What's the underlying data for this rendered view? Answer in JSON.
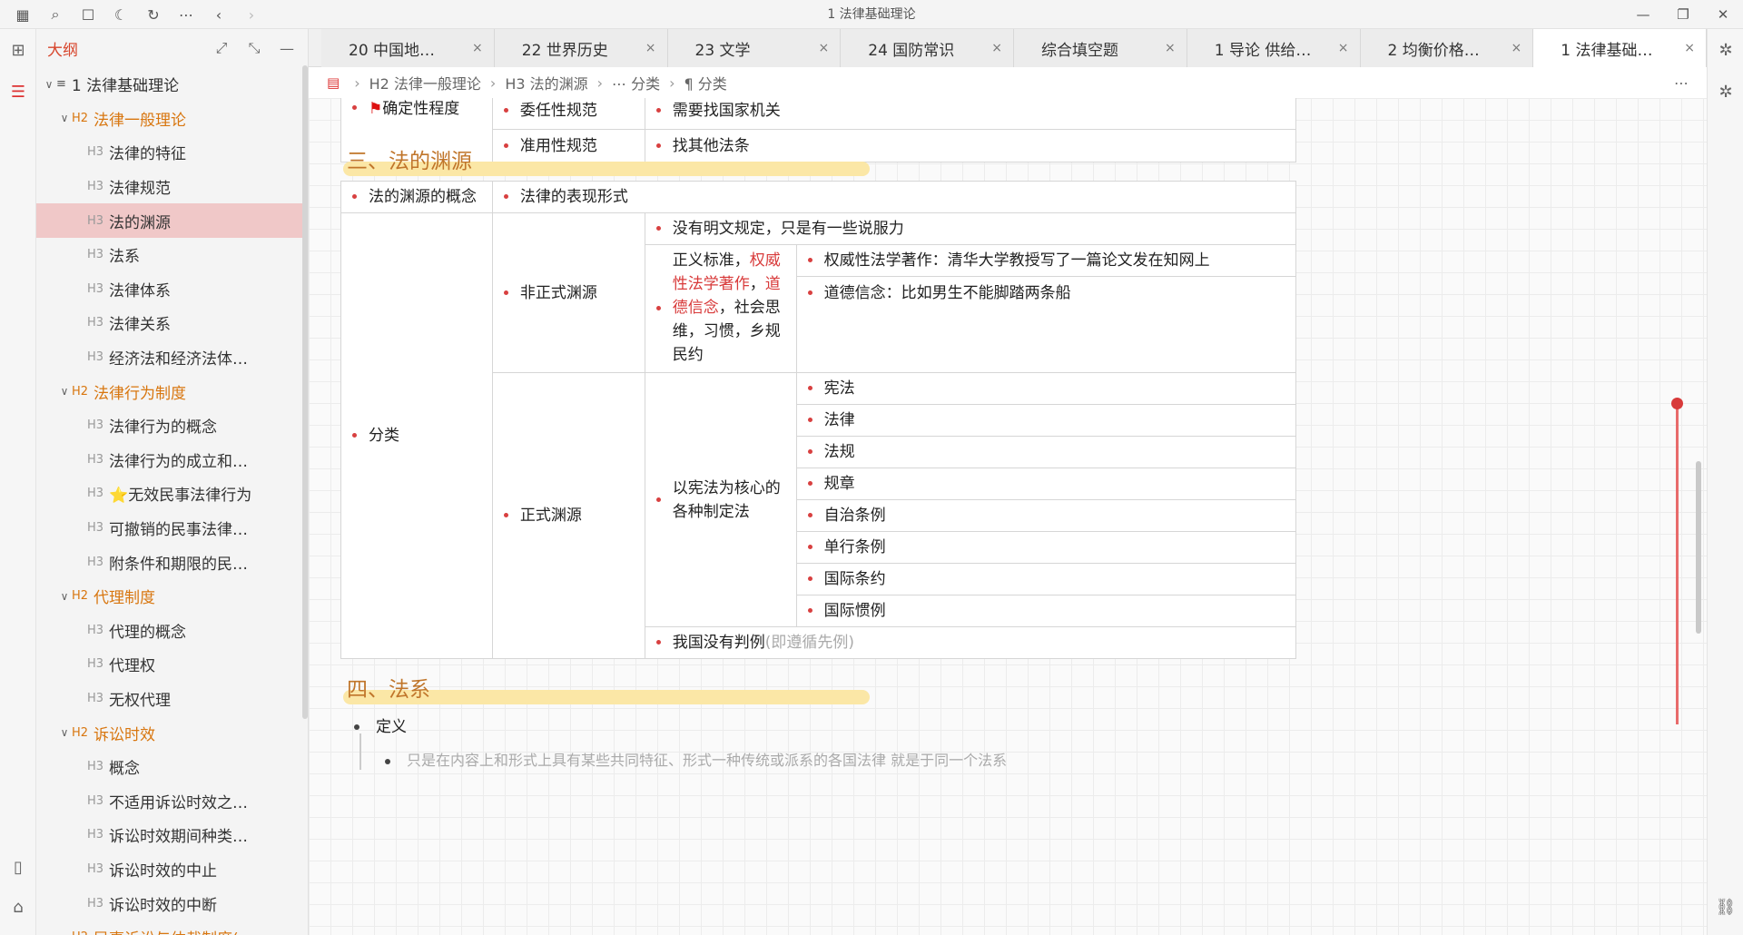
{
  "window": {
    "title": "1 法律基础理论"
  },
  "outline": {
    "title": "大纲",
    "items": [
      {
        "level": "",
        "text": "1 法律基础理论",
        "arrow": "∨",
        "indent": 0
      },
      {
        "level": "H2",
        "text": "法律一般理论",
        "arrow": "∨",
        "indent": 1
      },
      {
        "level": "H3",
        "text": "法律的特征",
        "arrow": "",
        "indent": 2
      },
      {
        "level": "H3",
        "text": "法律规范",
        "arrow": "",
        "indent": 2
      },
      {
        "level": "H3",
        "text": "法的渊源",
        "arrow": "",
        "indent": 2,
        "selected": true
      },
      {
        "level": "H3",
        "text": "法系",
        "arrow": "",
        "indent": 2
      },
      {
        "level": "H3",
        "text": "法律体系",
        "arrow": "",
        "indent": 2
      },
      {
        "level": "H3",
        "text": "法律关系",
        "arrow": "",
        "indent": 2
      },
      {
        "level": "H3",
        "text": "经济法和经济法体…",
        "arrow": "",
        "indent": 2
      },
      {
        "level": "H2",
        "text": "法律行为制度",
        "arrow": "∨",
        "indent": 1
      },
      {
        "level": "H3",
        "text": "法律行为的概念",
        "arrow": "",
        "indent": 2
      },
      {
        "level": "H3",
        "text": "法律行为的成立和…",
        "arrow": "",
        "indent": 2
      },
      {
        "level": "H3",
        "text": "⭐无效民事法律行为",
        "arrow": "",
        "indent": 2
      },
      {
        "level": "H3",
        "text": "可撤销的民事法律…",
        "arrow": "",
        "indent": 2
      },
      {
        "level": "H3",
        "text": "附条件和期限的民…",
        "arrow": "",
        "indent": 2
      },
      {
        "level": "H2",
        "text": "代理制度",
        "arrow": "∨",
        "indent": 1
      },
      {
        "level": "H3",
        "text": "代理的概念",
        "arrow": "",
        "indent": 2
      },
      {
        "level": "H3",
        "text": "代理权",
        "arrow": "",
        "indent": 2
      },
      {
        "level": "H3",
        "text": "无权代理",
        "arrow": "",
        "indent": 2
      },
      {
        "level": "H2",
        "text": "诉讼时效",
        "arrow": "∨",
        "indent": 1
      },
      {
        "level": "H3",
        "text": "概念",
        "arrow": "",
        "indent": 2
      },
      {
        "level": "H3",
        "text": "不适用诉讼时效之…",
        "arrow": "",
        "indent": 2
      },
      {
        "level": "H3",
        "text": "诉讼时效期间种类…",
        "arrow": "",
        "indent": 2
      },
      {
        "level": "H3",
        "text": "诉讼时效的中止",
        "arrow": "",
        "indent": 2
      },
      {
        "level": "H3",
        "text": "诉讼时效的中断",
        "arrow": "",
        "indent": 2
      },
      {
        "level": "H2",
        "text": "民事诉讼与仲裁制度(",
        "arrow": "∨",
        "indent": 1
      }
    ]
  },
  "tabs": [
    {
      "label": "20 中国地…",
      "active": false
    },
    {
      "label": "22 世界历史",
      "active": false
    },
    {
      "label": "23 文学",
      "active": false
    },
    {
      "label": "24 国防常识",
      "active": false
    },
    {
      "label": "综合填空题",
      "active": false
    },
    {
      "label": "1 导论 供给…",
      "active": false
    },
    {
      "label": "2 均衡价格…",
      "active": false
    },
    {
      "label": "1 法律基础…",
      "active": true
    }
  ],
  "breadcrumb": [
    "H2 法律一般理论",
    "H3 法的渊源",
    "⋯ 分类",
    "¶ 分类"
  ],
  "doc": {
    "table1": {
      "r1": {
        "c1": "确定性程度",
        "c2": "委任性规范",
        "c3": "需要找国家机关"
      },
      "r2": {
        "c2": "准用性规范",
        "c3": "找其他法条"
      }
    },
    "heading3": "三、法的渊源",
    "table2": {
      "concept_label": "法的渊源的概念",
      "concept_value": "法律的表现形式",
      "category": "分类",
      "informal": "非正式渊源",
      "informal_a": "没有明文规定，只是有一些说服力",
      "informal_b_p1": "正义标准，",
      "informal_b_red1": "权威性法学著作",
      "informal_b_p2": "，",
      "informal_b_red2": "道德信念",
      "informal_b_p3": "，社会思维，习惯，乡规民约",
      "informal_b1": "权威性法学著作：清华大学教授写了一篇论文发在知网上",
      "informal_b2": "道德信念：比如男生不能脚踏两条船",
      "formal": "正式渊源",
      "formal_core": "以宪法为核心的各种制定法",
      "formal_items": [
        "宪法",
        "法律",
        "法规",
        "规章",
        "自治条例",
        "单行条例",
        "国际条约",
        "国际惯例"
      ],
      "no_case_law": "我国没有判例",
      "no_case_law_gray": "(即遵循先例)"
    },
    "heading4": "四、法系",
    "def": "定义",
    "quote": "只是在内容上和形式上具有某些共同特征、形式一种传统或派系的各国法律 就是于同一个法系"
  }
}
